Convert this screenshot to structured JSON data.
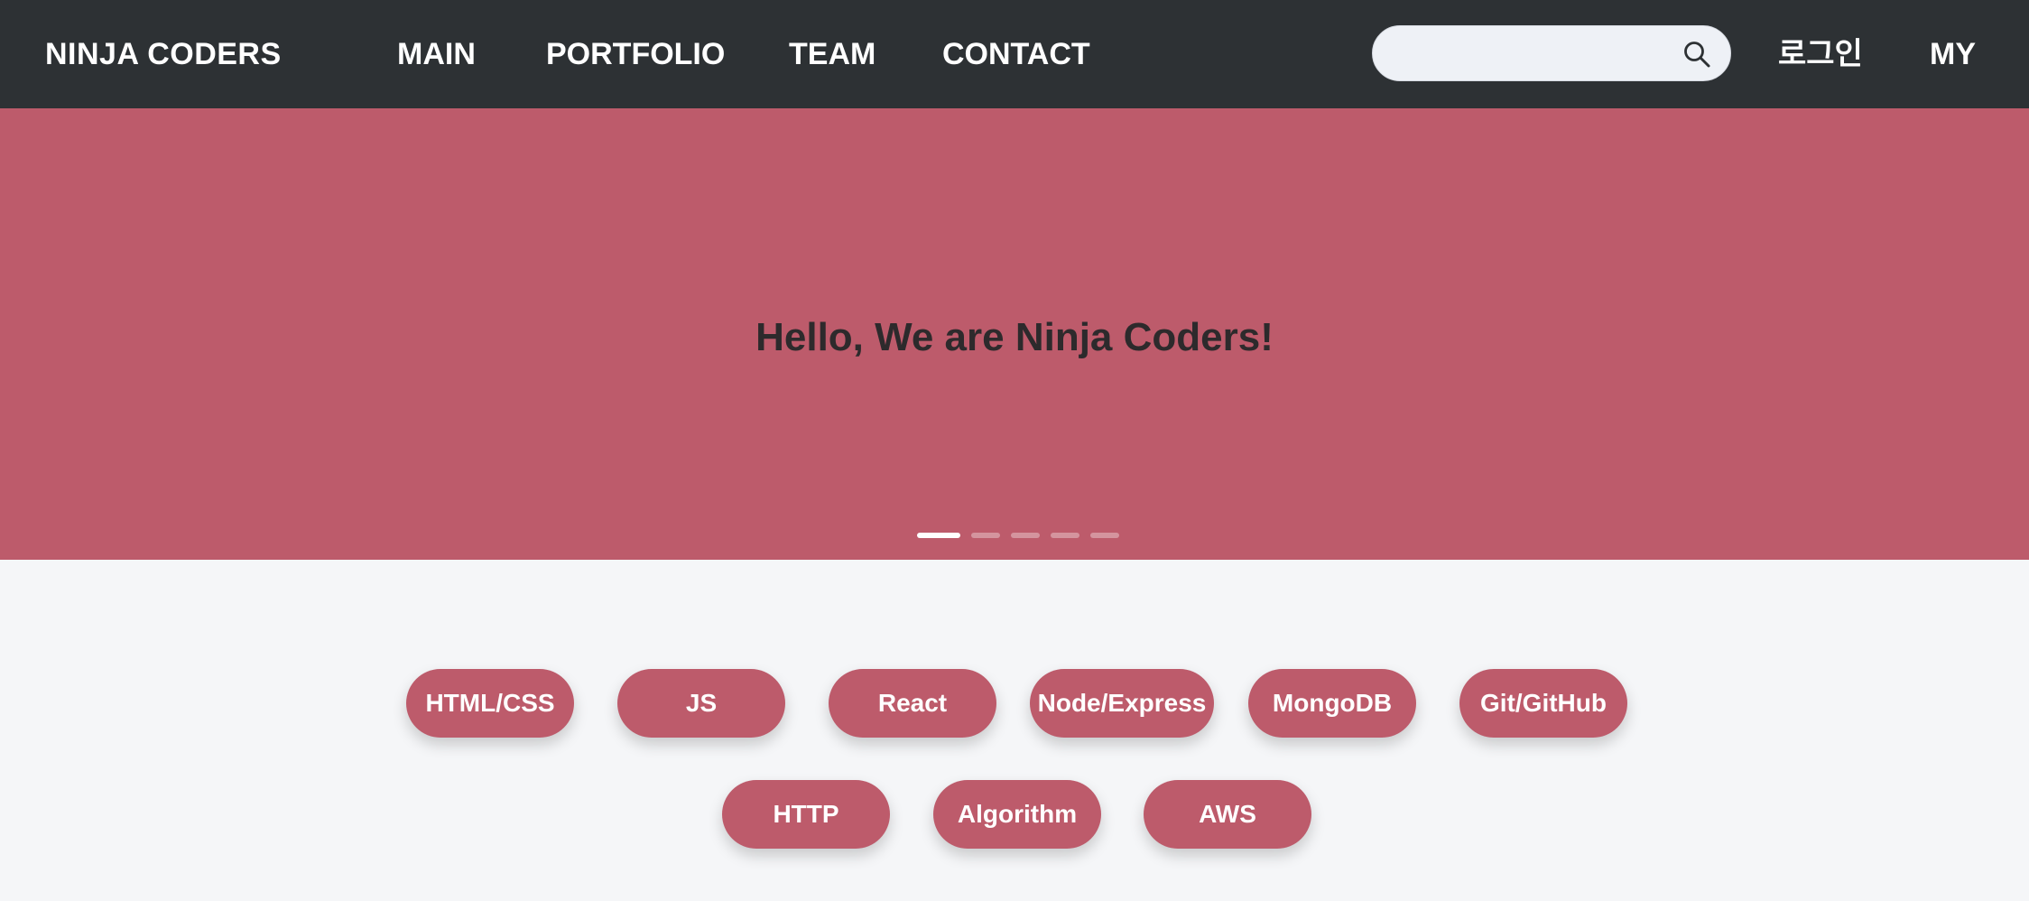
{
  "navbar": {
    "brand": "NINJA CODERS",
    "links": [
      "MAIN",
      "PORTFOLIO",
      "TEAM",
      "CONTACT"
    ],
    "search": {
      "value": "",
      "placeholder": "",
      "icon": "search-icon"
    },
    "login": "로그인",
    "my": "MY"
  },
  "hero": {
    "title": "Hello, We are Ninja Coders!",
    "slide_count": 5,
    "active_slide": 1
  },
  "skills": [
    "HTML/CSS",
    "JS",
    "React",
    "Node/Express",
    "MongoDB",
    "Git/GitHub",
    "HTTP",
    "Algorithm",
    "AWS"
  ],
  "colors": {
    "navbar": "#2d3134",
    "accent": "#bd5b6b",
    "background": "#f5f6f8"
  }
}
